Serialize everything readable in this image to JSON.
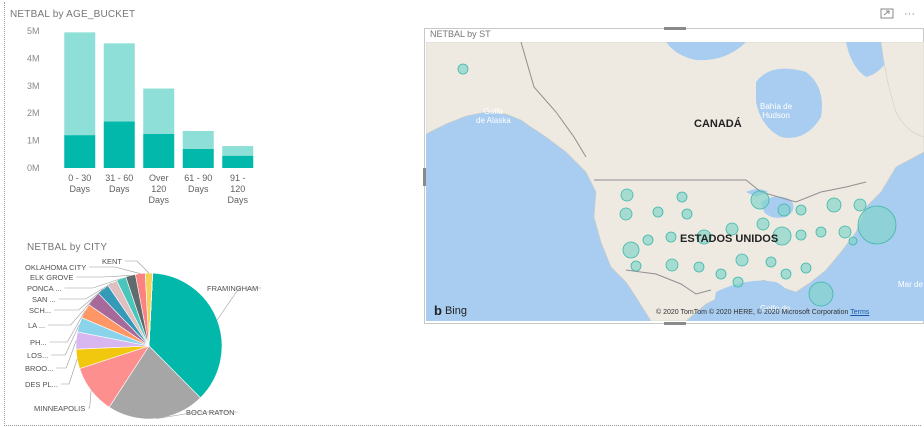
{
  "age_bucket": {
    "title": "NETBAL by AGE_BUCKET",
    "y_ticks": [
      "5M",
      "4M",
      "3M",
      "2M",
      "1M",
      "0M"
    ],
    "categories": [
      [
        "0 - 30",
        "Days"
      ],
      [
        "31 - 60",
        "Days"
      ],
      [
        "Over",
        "120",
        "Days"
      ],
      [
        "61 - 90",
        "Days"
      ],
      [
        "91 -",
        "120",
        "Days"
      ]
    ]
  },
  "chart_data": [
    {
      "type": "bar",
      "title": "NETBAL by AGE_BUCKET",
      "stacked": true,
      "categories": [
        "0 - 30 Days",
        "31 - 60 Days",
        "Over 120 Days",
        "61 - 90 Days",
        "91 - 120 Days"
      ],
      "series": [
        {
          "values": [
            1.2,
            1.7,
            1.25,
            0.7,
            0.45
          ]
        },
        {
          "values": [
            3.75,
            2.85,
            1.65,
            0.65,
            0.35
          ]
        }
      ],
      "ylim": [
        0,
        5
      ],
      "y_unit": "M",
      "colors": [
        "#01b8aa",
        "#8ddfd7"
      ]
    },
    {
      "type": "pie",
      "title": "NETBAL by CITY",
      "labels": [
        "FRAMINGHAM",
        "BOCA RATON",
        "MINNEAPOLIS",
        "DES PL...",
        "BROO...",
        "LOS...",
        "PH...",
        "LA ...",
        "SCH...",
        "SAN ...",
        "PONCA ...",
        "ELK GROVE",
        "OKLAHOMA CITY",
        "KENT"
      ],
      "values": [
        34,
        20,
        10,
        4,
        3.5,
        3,
        3,
        3,
        2.5,
        2,
        2,
        2,
        2,
        1.5
      ],
      "colors": [
        "#01b8aa",
        "#a6a6a6",
        "#fd8f8f",
        "#f2c80f",
        "#d8b6f0",
        "#8ad4eb",
        "#fe9666",
        "#a66999",
        "#3599b8",
        "#dfbfbf",
        "#4ac5bb",
        "#5f6b6d",
        "#fb8281",
        "#f4d25a"
      ]
    }
  ],
  "pie": {
    "title": "NETBAL by CITY"
  },
  "map": {
    "title": "NETBAL by ST",
    "labels": {
      "canada": "CANADÁ",
      "usa": "ESTADOS UNIDOS",
      "alaska": "Golfo\nde Alaska",
      "hudson": "Bahía de\nHudson",
      "mex": "Golfo de",
      "mar": "Mar de"
    },
    "bing": "Bing",
    "copyright": "© 2020 TomTom © 2020 HERE, © 2020 Microsoft Corporation",
    "terms": "Terms"
  },
  "icons": {
    "focus": "focus-mode-icon",
    "more": "more-options-icon"
  }
}
